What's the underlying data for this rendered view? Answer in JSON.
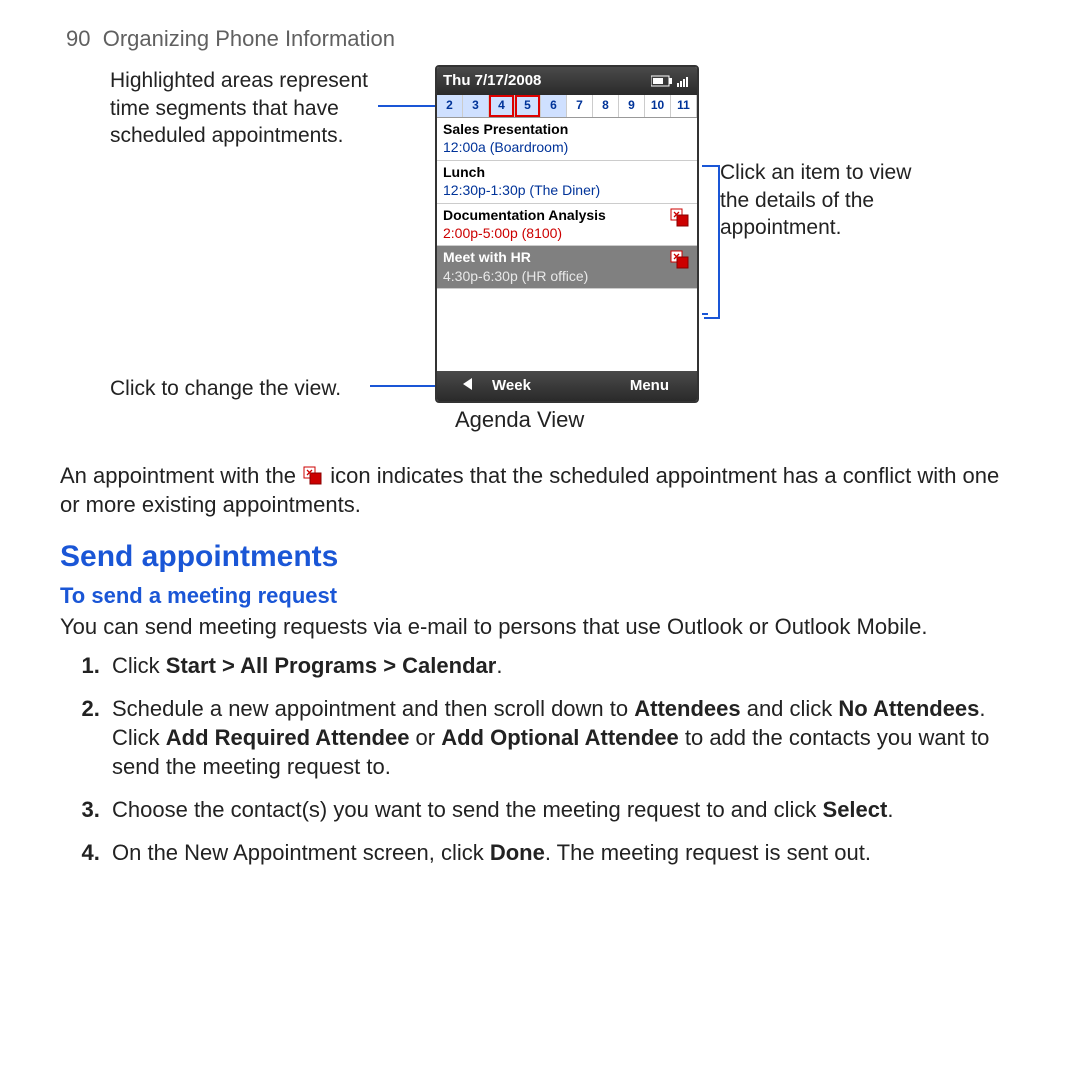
{
  "header": {
    "page_number": "90",
    "chapter": "Organizing Phone Information"
  },
  "diagram": {
    "callouts": {
      "highlight": "Highlighted areas represent time segments that have scheduled appointments.",
      "clickview": "Click to change the view.",
      "clickitem": "Click an item to view the details of the appointment."
    },
    "caption": "Agenda View",
    "phone": {
      "title_date": "Thu 7/17/2008",
      "hours": [
        "2",
        "3",
        "4",
        "5",
        "6",
        "7",
        "8",
        "9",
        "10",
        "11"
      ],
      "events": [
        {
          "title": "Sales Presentation",
          "sub": "12:00a (Boardroom)",
          "conflict": false,
          "selected": false,
          "red": false
        },
        {
          "title": "Lunch",
          "sub": "12:30p-1:30p (The Diner)",
          "conflict": false,
          "selected": false,
          "red": false
        },
        {
          "title": "Documentation Analysis",
          "sub": "2:00p-5:00p (8100)",
          "conflict": true,
          "selected": false,
          "red": true
        },
        {
          "title": "Meet with HR",
          "sub": "4:30p-6:30p (HR office)",
          "conflict": true,
          "selected": true,
          "red": false
        }
      ],
      "softkeys": {
        "left": "Week",
        "right": "Menu"
      }
    }
  },
  "body": {
    "icon_sentence_pre": "An appointment with the ",
    "icon_sentence_post": " icon indicates that the scheduled appointment has a conflict with one or more existing appointments.",
    "section_heading": "Send appointments",
    "sub_heading": "To send a meeting request",
    "intro": "You can send meeting requests via e-mail to persons that use Outlook or Outlook Mobile.",
    "steps": [
      {
        "pre": "Click ",
        "b1": "Start > All Programs > Calendar",
        "post": "."
      },
      {
        "pre": "Schedule a new appointment and then scroll down to ",
        "b1": "Attendees",
        "mid1": " and click ",
        "b2": "No Attendees",
        "mid2": ". Click ",
        "b3": "Add Required Attendee",
        "mid3": " or ",
        "b4": "Add Optional Attendee",
        "post": " to add the contacts you want to send the meeting request to."
      },
      {
        "pre": "Choose the contact(s) you want to send the meeting request to and click ",
        "b1": "Select",
        "post": "."
      },
      {
        "pre": "On the New Appointment screen, click ",
        "b1": "Done",
        "post": ". The meeting request is sent out."
      }
    ]
  }
}
